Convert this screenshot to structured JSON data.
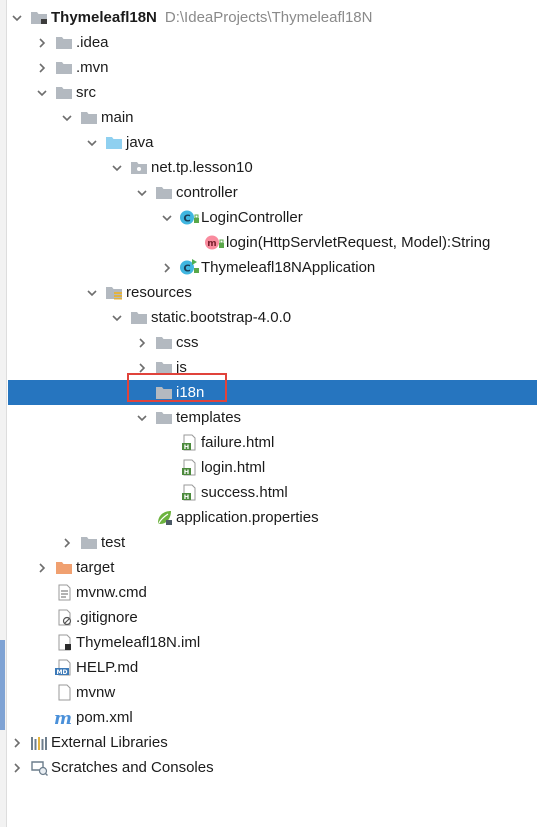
{
  "tree": {
    "items": [
      {
        "label": "Thymeleafl18N",
        "path": "D:\\IdeaProjects\\Thymeleafl18N",
        "icon": "module-folder-icon",
        "arrow": "expanded"
      },
      {
        "label": ".idea",
        "icon": "folder-icon",
        "arrow": "collapsed"
      },
      {
        "label": ".mvn",
        "icon": "folder-icon",
        "arrow": "collapsed"
      },
      {
        "label": "src",
        "icon": "folder-icon",
        "arrow": "expanded"
      },
      {
        "label": "main",
        "icon": "folder-icon",
        "arrow": "expanded"
      },
      {
        "label": "java",
        "icon": "source-folder-icon",
        "arrow": "expanded"
      },
      {
        "label": "net.tp.lesson10",
        "icon": "package-icon",
        "arrow": "expanded"
      },
      {
        "label": "controller",
        "icon": "folder-icon",
        "arrow": "expanded"
      },
      {
        "label": "LoginController",
        "icon": "class-icon",
        "arrow": "expanded"
      },
      {
        "label": "login(HttpServletRequest, Model):String",
        "icon": "method-icon",
        "arrow": "none"
      },
      {
        "label": "Thymeleafl18NApplication",
        "icon": "spring-boot-class-icon",
        "arrow": "collapsed"
      },
      {
        "label": "resources",
        "icon": "resources-folder-icon",
        "arrow": "expanded"
      },
      {
        "label": "static.bootstrap-4.0.0",
        "icon": "folder-icon",
        "arrow": "expanded"
      },
      {
        "label": "css",
        "icon": "folder-icon",
        "arrow": "collapsed"
      },
      {
        "label": "js",
        "icon": "folder-icon",
        "arrow": "collapsed"
      },
      {
        "label": "i18n",
        "icon": "folder-icon",
        "arrow": "none",
        "selected": true
      },
      {
        "label": "templates",
        "icon": "folder-icon",
        "arrow": "expanded"
      },
      {
        "label": "failure.html",
        "icon": "html-file-icon",
        "arrow": "none"
      },
      {
        "label": "login.html",
        "icon": "html-file-icon",
        "arrow": "none"
      },
      {
        "label": "success.html",
        "icon": "html-file-icon",
        "arrow": "none"
      },
      {
        "label": "application.properties",
        "icon": "spring-properties-icon",
        "arrow": "none"
      },
      {
        "label": "test",
        "icon": "folder-icon",
        "arrow": "collapsed"
      },
      {
        "label": "target",
        "icon": "excluded-folder-icon",
        "arrow": "collapsed"
      },
      {
        "label": "mvnw.cmd",
        "icon": "text-file-icon",
        "arrow": "none"
      },
      {
        "label": ".gitignore",
        "icon": "gitignore-file-icon",
        "arrow": "none"
      },
      {
        "label": "Thymeleafl18N.iml",
        "icon": "iml-file-icon",
        "arrow": "none"
      },
      {
        "label": "HELP.md",
        "icon": "markdown-file-icon",
        "arrow": "none"
      },
      {
        "label": "mvnw",
        "icon": "file-icon",
        "arrow": "none"
      },
      {
        "label": "pom.xml",
        "icon": "maven-icon",
        "arrow": "none"
      },
      {
        "label": "External Libraries",
        "icon": "libraries-icon",
        "arrow": "collapsed"
      },
      {
        "label": "Scratches and Consoles",
        "icon": "scratches-icon",
        "arrow": "collapsed"
      }
    ]
  },
  "colors": {
    "selection": "#2675bf",
    "folder": "#b3b9c0",
    "source_folder": "#8fd0f0",
    "excluded_folder": "#f0a070",
    "class_badge": "#40b6e0",
    "method_badge": "#f98b9e",
    "highlight_border": "#e0433b"
  }
}
